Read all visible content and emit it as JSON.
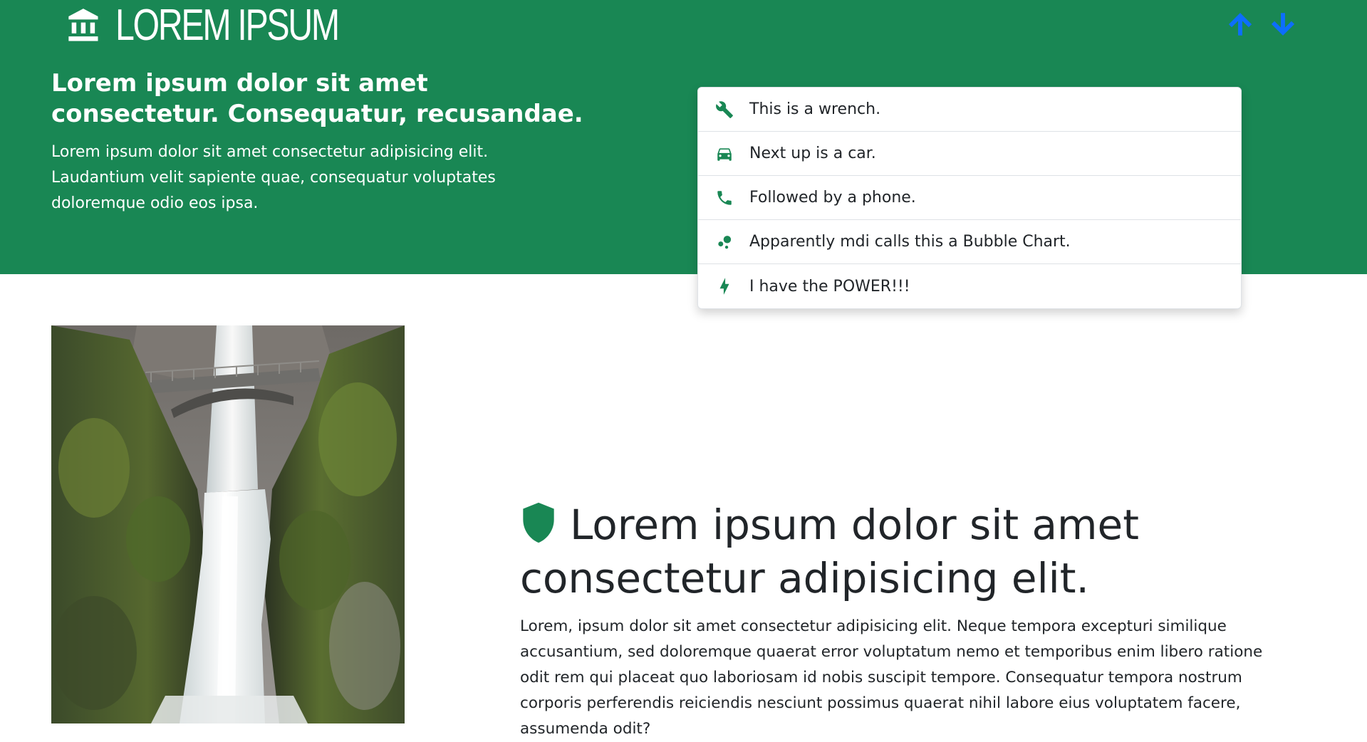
{
  "brand": {
    "title": "LOREM IPSUM",
    "icon": "bank-icon"
  },
  "nav": {
    "up_icon": "arrow-up-icon",
    "down_icon": "arrow-down-icon"
  },
  "hero": {
    "heading": "Lorem ipsum dolor sit amet consectetur. Consequatur, recusandae.",
    "text": "Lorem ipsum dolor sit amet consectetur adipisicing elit. Laudantium velit sapiente quae, consequatur voluptates doloremque odio eos ipsa."
  },
  "list": {
    "items": [
      {
        "icon": "wrench-icon",
        "label": "This is a wrench."
      },
      {
        "icon": "car-icon",
        "label": "Next up is a car."
      },
      {
        "icon": "phone-icon",
        "label": "Followed by a phone."
      },
      {
        "icon": "bubble-chart-icon",
        "label": " Apparently mdi calls this a Bubble Chart."
      },
      {
        "icon": "lightning-bolt-icon",
        "label": "I have the POWER!!!"
      }
    ]
  },
  "feature": {
    "icon": "shield-icon",
    "heading": "Lorem ipsum dolor sit amet consectetur adipisicing elit.",
    "text": "Lorem, ipsum dolor sit amet consectetur adipisicing elit. Neque tempora excepturi similique accusantium, sed doloremque quaerat error voluptatum nemo et temporibus enim libero ratione odit rem qui placeat quo laboriosam id nobis suscipit tempore. Consequatur tempora nostrum corporis perferendis reiciendis nesciunt possimus quaerat nihil labore eius voluptatem facere, assumenda odit?"
  },
  "photo": {
    "subject": "waterfall-with-bridge-photo"
  },
  "colors": {
    "primary_green": "#198754",
    "arrow_blue": "#0d6efd",
    "text_dark": "#212529"
  }
}
